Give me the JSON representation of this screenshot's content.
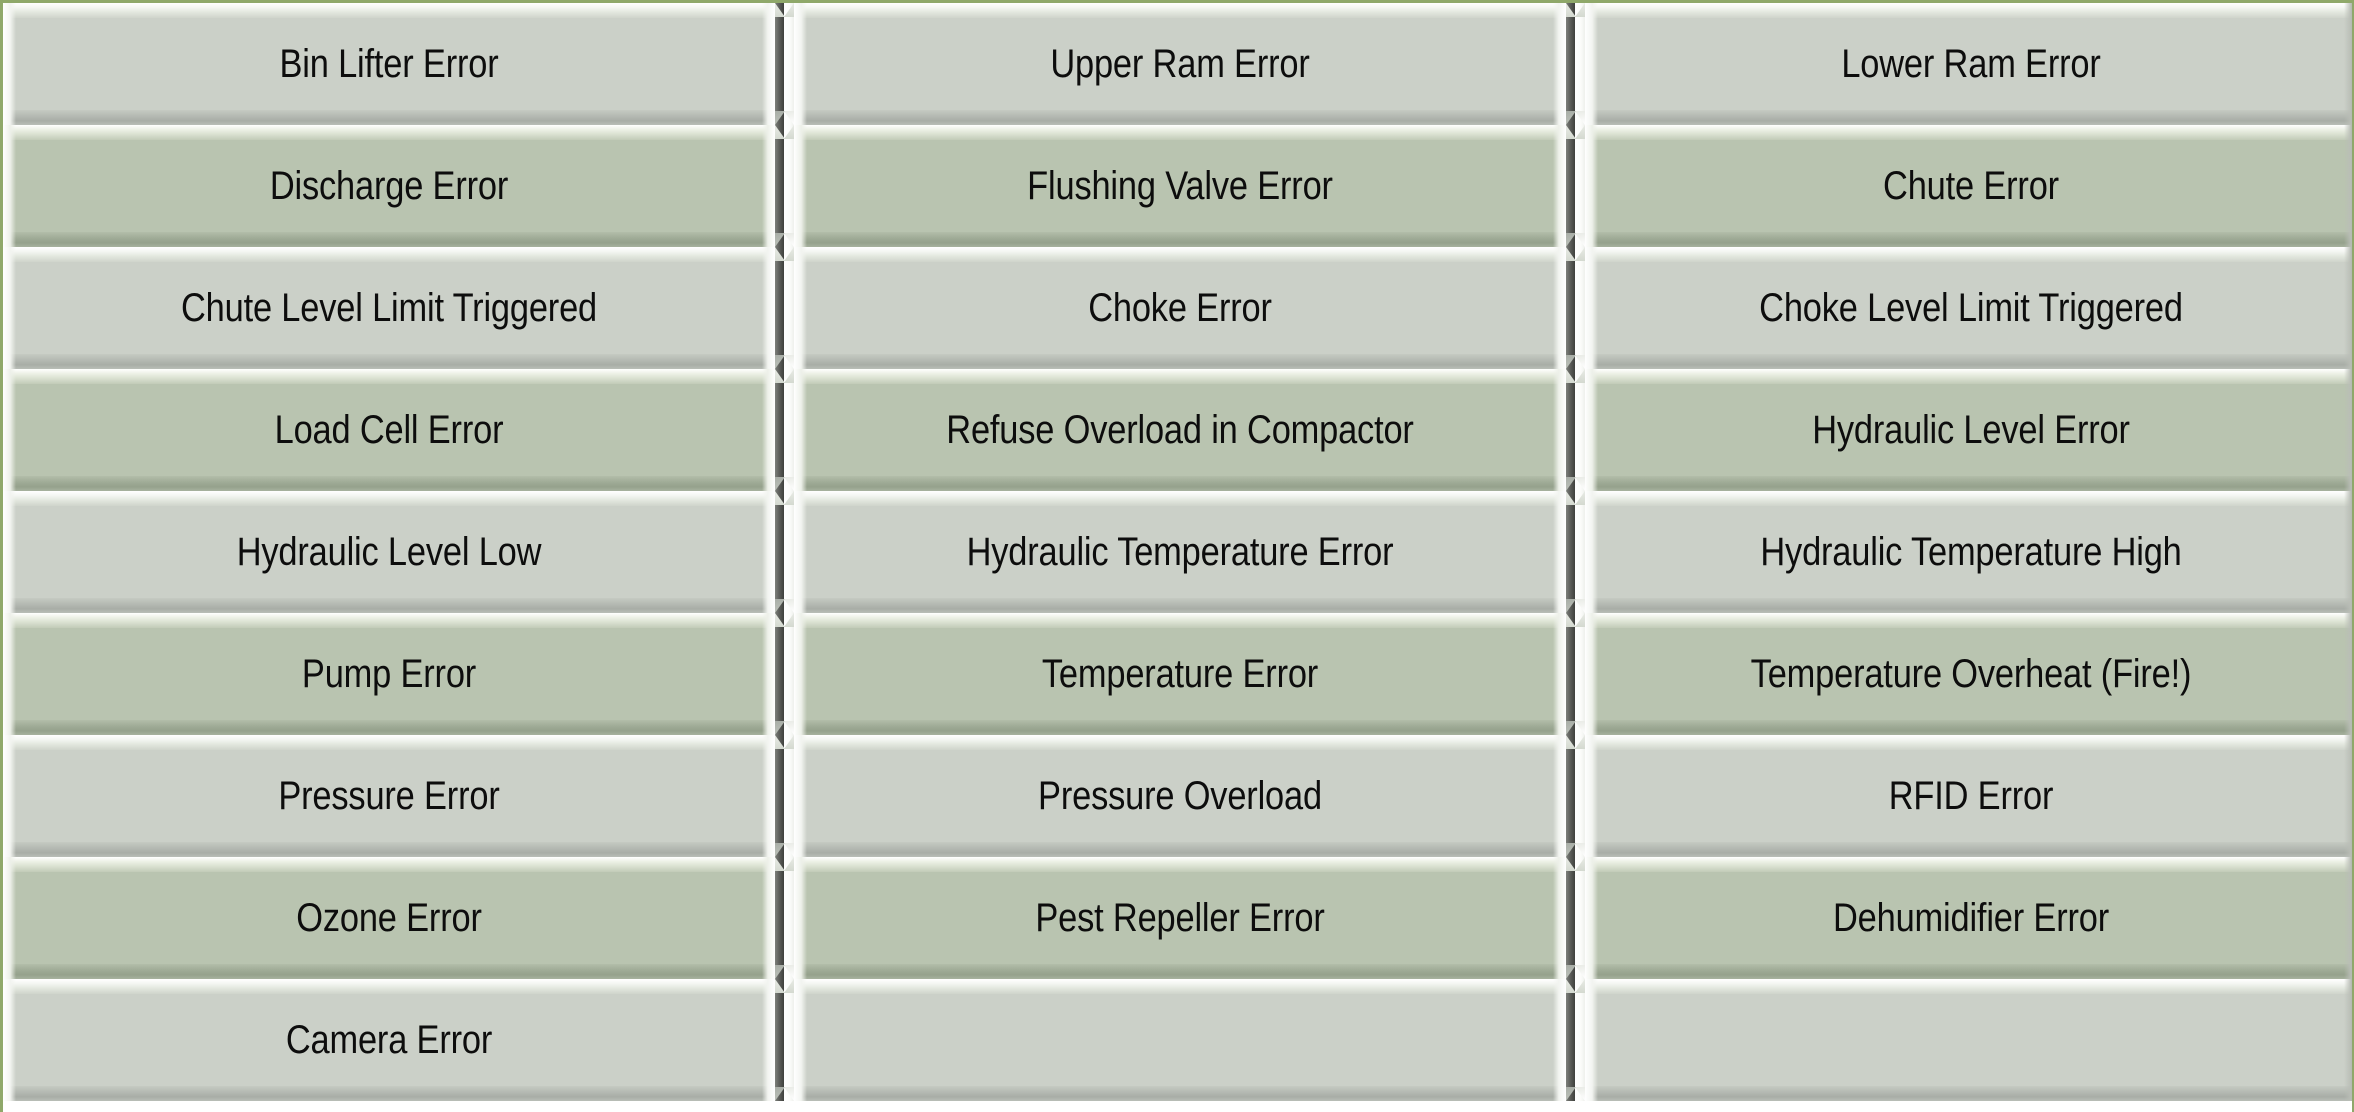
{
  "table": {
    "columns": 3,
    "rows": 9,
    "colors": {
      "row_light": "#CBD0C8",
      "row_dark": "#B9C4B0",
      "text": "#0D0D0D",
      "frame_border": "#8FA86A",
      "bevel_shadow": "#3F403D",
      "bevel_highlight": "#FFFFFF"
    },
    "cells": [
      [
        "Bin Lifter Error",
        "Upper Ram Error",
        "Lower Ram Error"
      ],
      [
        "Discharge Error",
        "Flushing Valve Error",
        "Chute Error"
      ],
      [
        "Chute Level Limit Triggered",
        "Choke Error",
        "Choke Level Limit Triggered"
      ],
      [
        "Load Cell Error",
        "Refuse Overload in Compactor",
        "Hydraulic Level Error"
      ],
      [
        "Hydraulic Level Low",
        "Hydraulic Temperature Error",
        "Hydraulic Temperature High"
      ],
      [
        "Pump Error",
        "Temperature Error",
        "Temperature Overheat (Fire!)"
      ],
      [
        "Pressure Error",
        "Pressure Overload",
        "RFID Error"
      ],
      [
        "Ozone Error",
        "Pest Repeller Error",
        "Dehumidifier Error"
      ],
      [
        "Camera Error",
        "",
        ""
      ]
    ]
  }
}
